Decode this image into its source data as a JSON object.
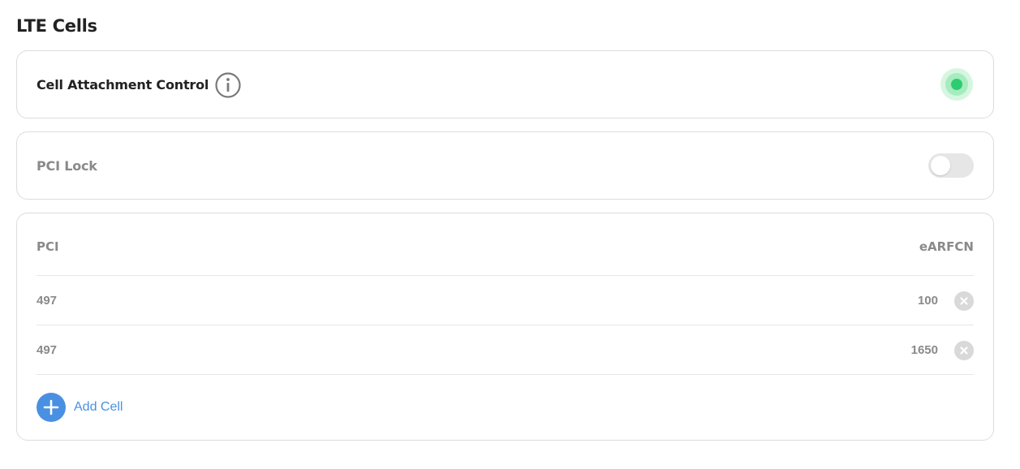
{
  "section": {
    "title": "LTE Cells"
  },
  "attachment_control": {
    "label": "Cell Attachment Control",
    "info_icon": "info-circle-icon",
    "status": "active",
    "status_color": "#2ecc71"
  },
  "pci_lock": {
    "label": "PCI Lock",
    "enabled": false
  },
  "cells_table": {
    "columns": {
      "pci": "PCI",
      "earfcn": "eARFCN"
    },
    "rows": [
      {
        "pci": "497",
        "earfcn": "100"
      },
      {
        "pci": "497",
        "earfcn": "1650"
      }
    ],
    "remove_icon": "close-circle-icon",
    "add_label": "Add Cell",
    "add_icon": "plus-circle-icon",
    "accent_color": "#4a90e2"
  }
}
